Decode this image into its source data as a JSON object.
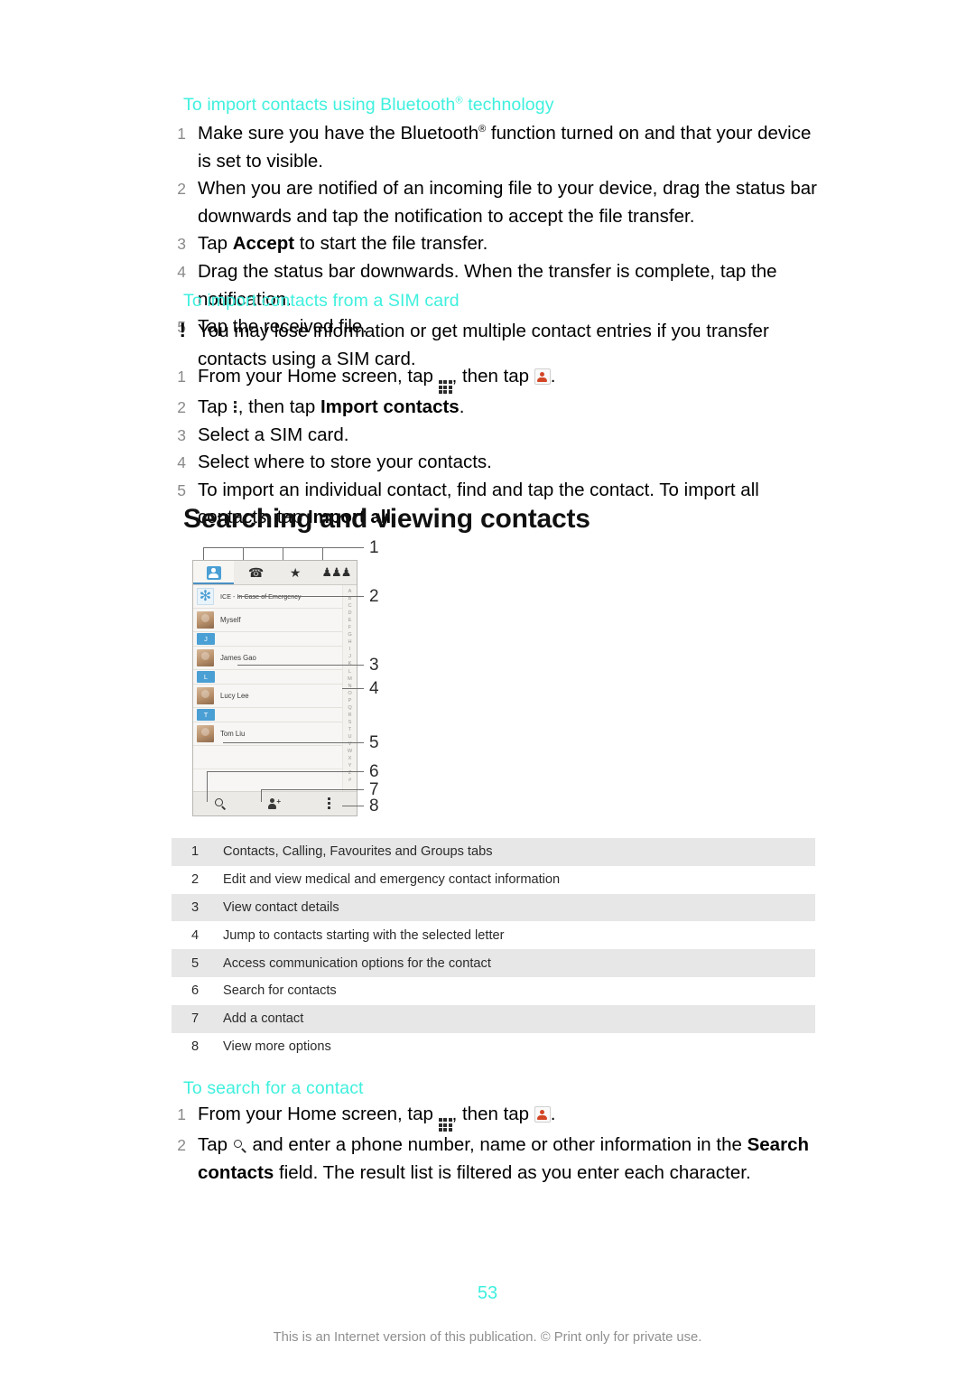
{
  "sections": {
    "bluetooth": {
      "heading_pre": "To import contacts using Bluetooth",
      "heading_sup": "®",
      "heading_post": " technology",
      "steps": [
        {
          "num": "1",
          "text": "Make sure you have the Bluetooth® function turned on and that your device is set to visible."
        },
        {
          "num": "2",
          "text": "When you are notified of an incoming file to your device, drag the status bar downwards and tap the notification to accept the file transfer."
        },
        {
          "num": "3",
          "text": "Tap Accept to start the file transfer."
        },
        {
          "num": "4",
          "text": "Drag the status bar downwards. When the transfer is complete, tap the notification."
        },
        {
          "num": "5",
          "text": "Tap the received file."
        }
      ]
    },
    "sim": {
      "heading": "To import contacts from a SIM card",
      "note_mark": "!",
      "note_text": "You may lose information or get multiple contact entries if you transfer contacts using a SIM card.",
      "steps": [
        {
          "num": "1",
          "text": "From your Home screen, tap [appdrawer], then tap [contacts]."
        },
        {
          "num": "2",
          "text": "Tap [menu], then tap Import contacts."
        },
        {
          "num": "3",
          "text": "Select a SIM card."
        },
        {
          "num": "4",
          "text": "Select where to store your contacts."
        },
        {
          "num": "5",
          "text": "To import an individual contact, find and tap the contact. To import all contacts, tap Import all."
        }
      ]
    },
    "searching": {
      "title": "Searching and viewing contacts"
    },
    "search_contact": {
      "heading": "To search for a contact",
      "steps": [
        {
          "num": "1",
          "text": "From your Home screen, tap [appdrawer], then tap [contacts]."
        },
        {
          "num": "2",
          "text": "Tap [search] and enter a phone number, name or other information in the Search contacts field. The result list is filtered as you enter each character."
        }
      ]
    }
  },
  "figure": {
    "tabs": [
      {
        "name": "contacts-tab",
        "icon": "contacts-icon",
        "active": true
      },
      {
        "name": "calling-tab",
        "icon": "phone-handset-icon",
        "glyph": "✆",
        "active": false
      },
      {
        "name": "favourites-tab",
        "icon": "star-icon",
        "glyph": "★",
        "active": false
      },
      {
        "name": "groups-tab",
        "icon": "groups-icon",
        "glyph": "♟♟♟",
        "active": false
      }
    ],
    "list": [
      {
        "type": "contact",
        "avatar": "ice",
        "name": "ICE - In Case of Emergency"
      },
      {
        "type": "contact",
        "avatar": "photo",
        "name": "Myself"
      },
      {
        "type": "header",
        "letter": "J"
      },
      {
        "type": "contact",
        "avatar": "photo",
        "name": "James Gao"
      },
      {
        "type": "header",
        "letter": "L"
      },
      {
        "type": "contact",
        "avatar": "photo",
        "name": "Lucy Lee"
      },
      {
        "type": "header",
        "letter": "T"
      },
      {
        "type": "contact",
        "avatar": "photo",
        "name": "Tom Liu"
      }
    ],
    "alpha_index": [
      "A",
      "B",
      "C",
      "D",
      "E",
      "F",
      "G",
      "H",
      "I",
      "J",
      "K",
      "L",
      "M",
      "N",
      "O",
      "P",
      "Q",
      "R",
      "S",
      "T",
      "U",
      "V",
      "W",
      "X",
      "Y",
      "Z",
      "#"
    ],
    "bottom_bar": [
      {
        "name": "search-contacts-button",
        "icon": "search-icon"
      },
      {
        "name": "add-contact-button",
        "icon": "add-person-icon"
      },
      {
        "name": "more-options-button",
        "icon": "overflow-menu-icon"
      }
    ],
    "callouts": [
      "1",
      "2",
      "3",
      "4",
      "5",
      "6",
      "7",
      "8"
    ]
  },
  "legend": {
    "rows": [
      {
        "num": "1",
        "text": "Contacts, Calling, Favourites and Groups tabs"
      },
      {
        "num": "2",
        "text": "Edit and view medical and emergency contact information"
      },
      {
        "num": "3",
        "text": "View contact details"
      },
      {
        "num": "4",
        "text": "Jump to contacts starting with the selected letter"
      },
      {
        "num": "5",
        "text": "Access communication options for the contact"
      },
      {
        "num": "6",
        "text": "Search for contacts"
      },
      {
        "num": "7",
        "text": "Add a contact"
      },
      {
        "num": "8",
        "text": "View more options"
      }
    ]
  },
  "footer": {
    "page_number": "53",
    "note": "This is an Internet version of this publication. © Print only for private use."
  },
  "colors": {
    "heading_accent": "#3FF0DE",
    "step_number": "#8a8a8a",
    "legend_shade": "#e7e7e7",
    "footer_note": "#8f8f8f",
    "tab_active": "#4a9fd4"
  }
}
